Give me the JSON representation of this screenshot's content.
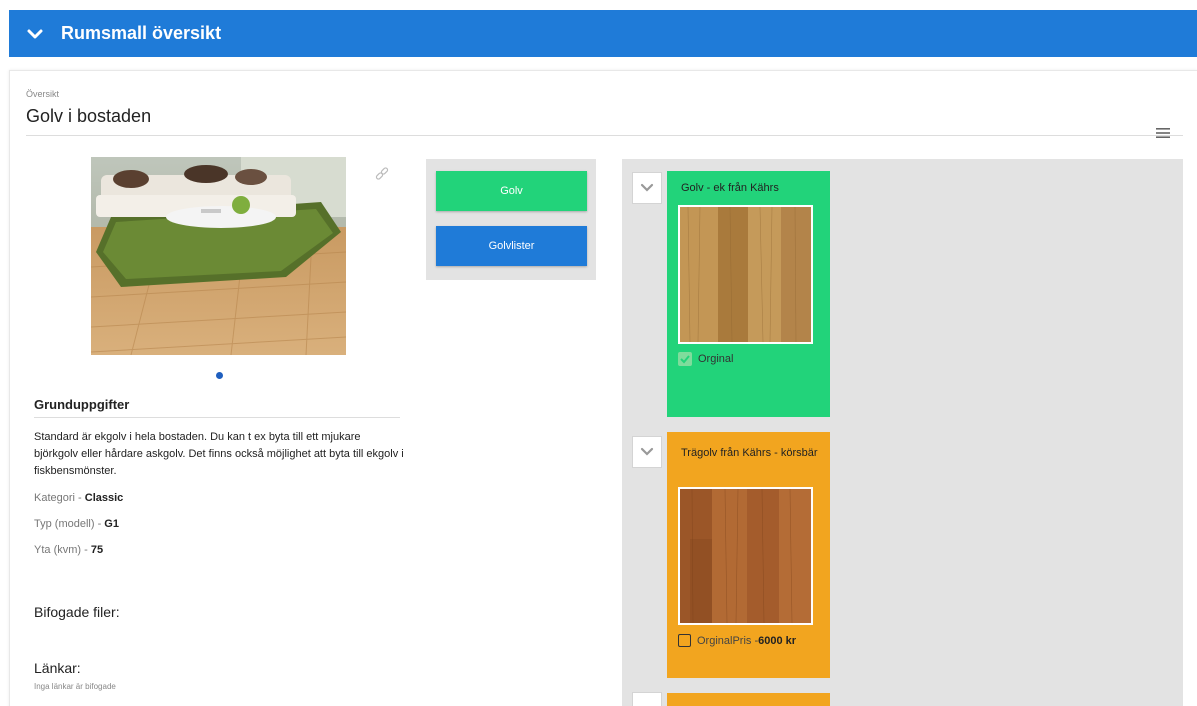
{
  "header": {
    "title": "Rumsmall översikt"
  },
  "card": {
    "subtitle": "Översikt",
    "title": "Golv i bostaden"
  },
  "details": {
    "heading": "Grunduppgifter",
    "description": "Standard är ekgolv i hela bostaden. Du kan t ex byta till ett mjukare björkgolv eller hårdare askgolv. Det finns också möjlighet att byta till ekgolv i fiskbensmönster.",
    "kategori_label": "Kategori - ",
    "kategori_value": "Classic",
    "typ_label": "Typ (modell) - ",
    "typ_value": "G1",
    "yta_label": "Yta (kvm) - ",
    "yta_value": "75"
  },
  "files": {
    "heading": "Bifogade filer:"
  },
  "links": {
    "heading": "Länkar:",
    "empty_text": "Inga länkar är bifogade"
  },
  "categories": [
    {
      "label": "Golv",
      "color": "#22d37a"
    },
    {
      "label": "Golvlister",
      "color": "#1f7bd8"
    }
  ],
  "products": [
    {
      "name": "Golv - ek från Kährs",
      "option_label": "Orginal",
      "option_price": "",
      "checked": true,
      "color": "#22d37a",
      "wood": "oak"
    },
    {
      "name": "Trägolv från Kährs - körsbär",
      "option_label": "OrginalPris - ",
      "option_price": "6000 kr",
      "checked": false,
      "color": "#f2a51f",
      "wood": "cherry"
    }
  ],
  "colors": {
    "primary": "#1f7bd8",
    "success": "#22d37a",
    "warning": "#f2a51f",
    "panel": "#e3e3e3"
  },
  "icons": [
    "chevron-down-icon",
    "menu-icon",
    "link-icon",
    "checkbox-icon"
  ]
}
